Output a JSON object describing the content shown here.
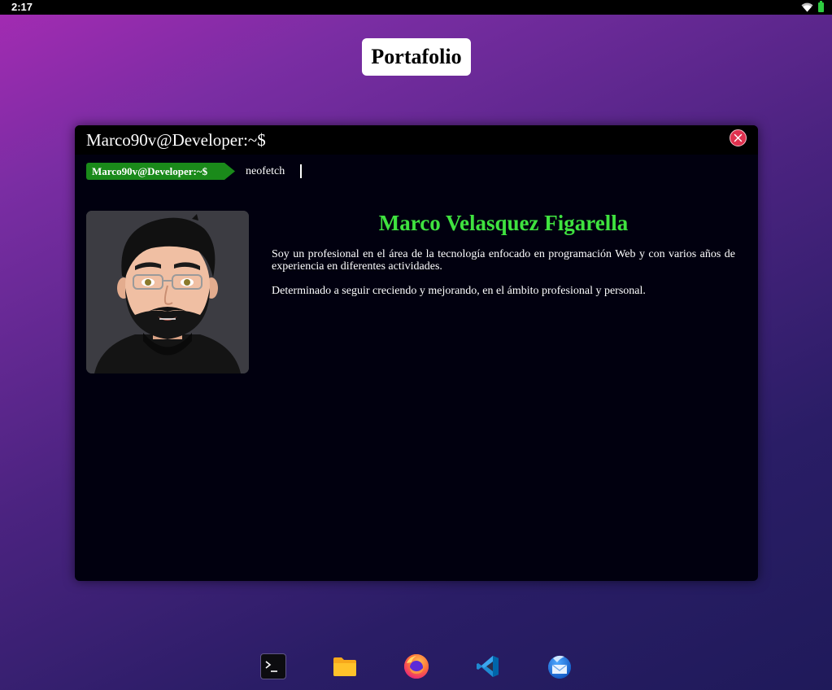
{
  "status_bar": {
    "time": "2:17",
    "wifi_icon": "wifi-icon",
    "battery_icon": "battery-icon",
    "battery_color": "#2ecc40"
  },
  "page": {
    "title": "Portafolio"
  },
  "terminal": {
    "window_title": "Marco90v@Developer:~$",
    "close_icon": "close-icon",
    "close_color": "#e0314f",
    "prompt": "Marco90v@Developer:~$",
    "prompt_color": "#1a8a1a",
    "command": "neofetch",
    "avatar": "avatar-image",
    "name": "Marco Velasquez Figarella",
    "name_color": "#3fe23f",
    "bio": [
      "Soy un profesional en el área de la tecnología enfocado en programación Web y con varios años de experiencia en diferentes actividades.",
      "Determinado a seguir creciendo y mejorando, en el ámbito profesional y personal."
    ]
  },
  "dock": [
    {
      "icon": "terminal-icon"
    },
    {
      "icon": "folder-icon"
    },
    {
      "icon": "firefox-icon"
    },
    {
      "icon": "vscode-icon"
    },
    {
      "icon": "thunderbird-icon"
    }
  ]
}
